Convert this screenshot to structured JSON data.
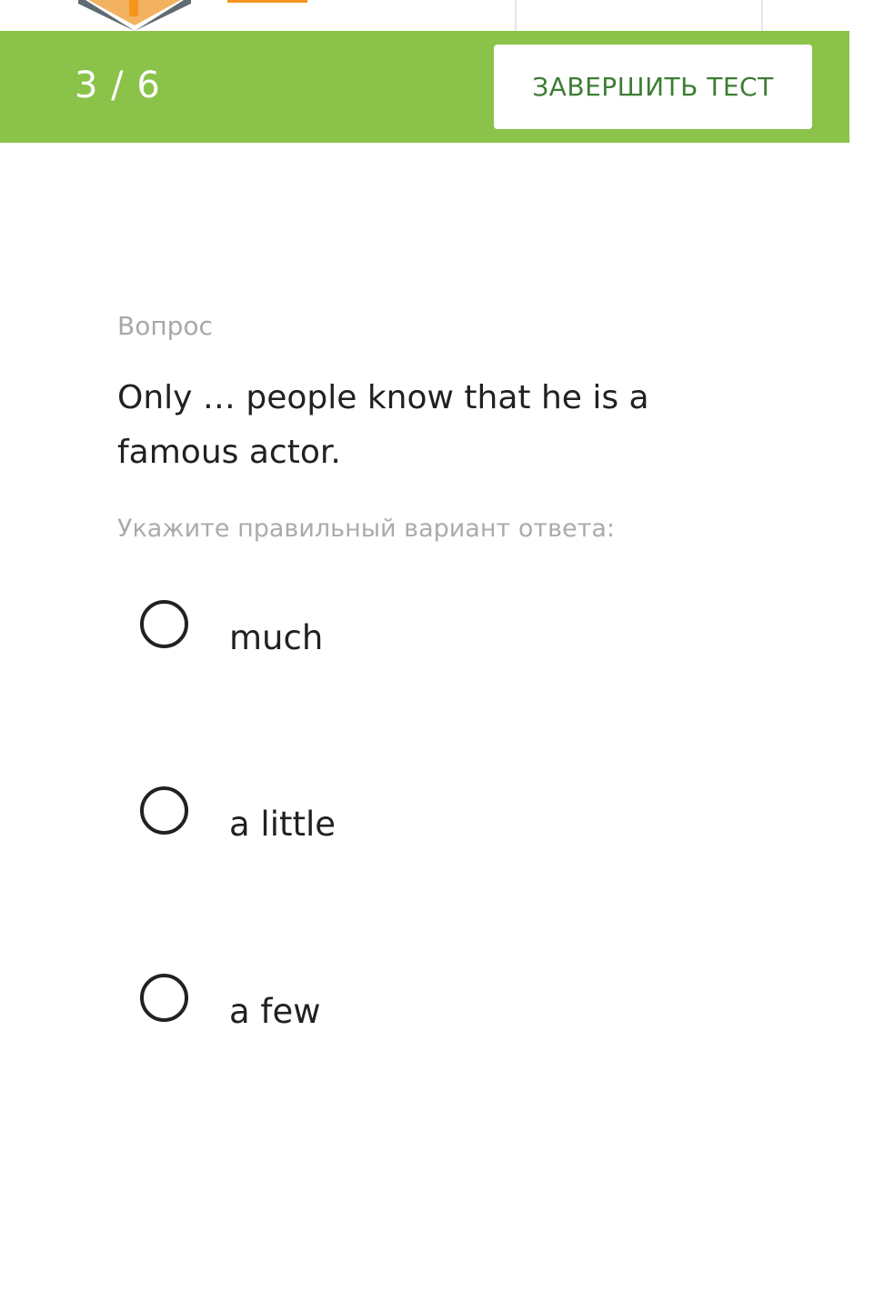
{
  "header": {
    "question_counter": "3 / 6",
    "finish_label": "ЗАВЕРШИТЬ ТЕСТ"
  },
  "question": {
    "label": "Вопрос",
    "text": "Only … people know that he is a famous actor.",
    "instruction": "Укажите правильный вариант ответа:"
  },
  "options": [
    {
      "label": "much",
      "selected": false
    },
    {
      "label": "a little",
      "selected": false
    },
    {
      "label": "a few",
      "selected": false
    }
  ],
  "colors": {
    "accent_green": "#8bc34a",
    "button_text_green": "#3d7d35",
    "logo_orange": "#f7941d",
    "logo_gray": "#5f6b73"
  }
}
